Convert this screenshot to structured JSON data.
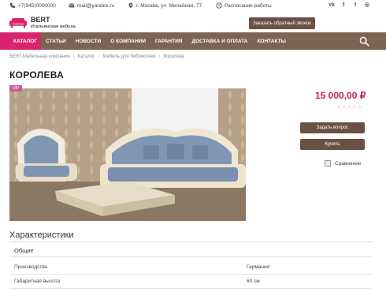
{
  "topbar": {
    "phone": "+7(945)0000000",
    "email": "mail@yandex.ru",
    "address": "г. Москва, ул. Милейная, 77",
    "schedule": "Расписание работы"
  },
  "logo": {
    "title": "BERT",
    "subtitle": "Итальянская мебель"
  },
  "callback_label": "Заказать обратный звонок",
  "nav": [
    "КАТАЛОГ",
    "СТАТЬИ",
    "НОВОСТИ",
    "О КОМПАНИИ",
    "ГАРАНТИЯ",
    "ДОСТАВКА И ОПЛАТА",
    "КОНТАКТЫ"
  ],
  "breadcrumb": [
    "BERT.Мебельная компания",
    "Каталог",
    "Мебель для библиотеки",
    "Королева"
  ],
  "product": {
    "title": "КОРОЛЕВА",
    "badge": "VIP",
    "price": "15 000,00 ₽",
    "ask_label": "Задать вопрос",
    "buy_label": "Купить",
    "compare_label": "Сравнение"
  },
  "specs": {
    "title": "Характеристики",
    "group": "Общие",
    "rows": [
      {
        "key": "Производство",
        "value": "Германия"
      },
      {
        "key": "Габаритная высота",
        "value": "60 см"
      }
    ]
  },
  "colors": {
    "accent": "#d8246c",
    "nav": "#7d6352",
    "button": "#6b5144",
    "price": "#c21f5f"
  }
}
